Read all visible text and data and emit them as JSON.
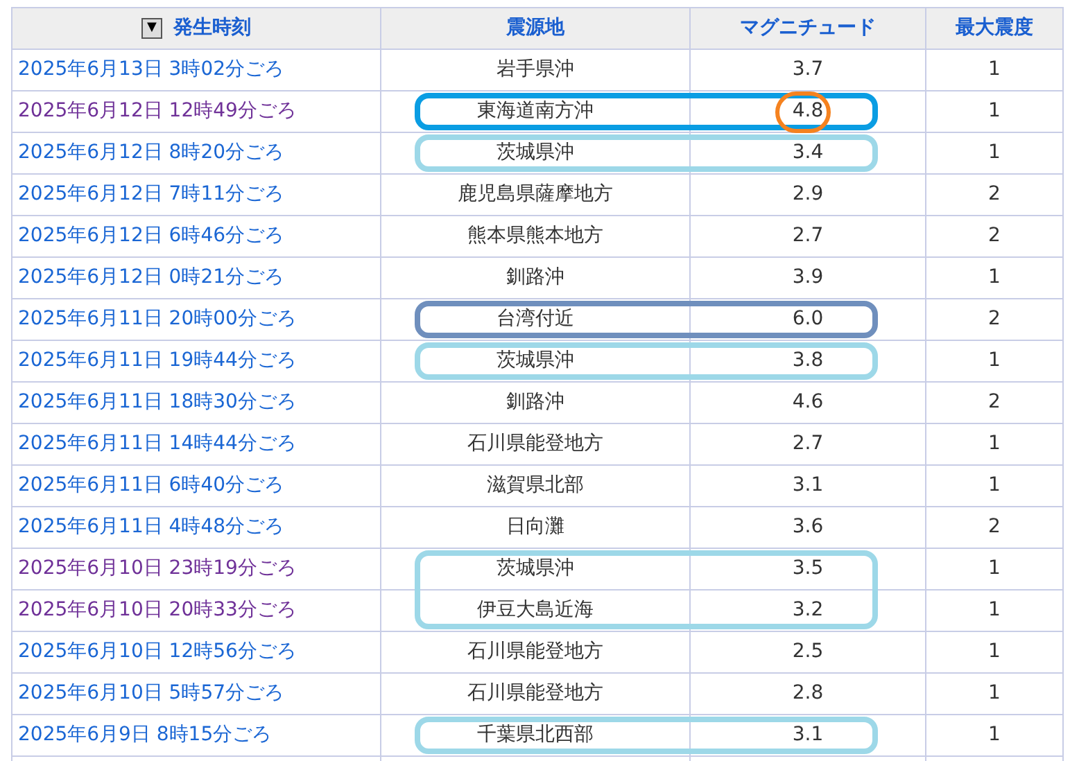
{
  "table": {
    "sort_icon": "▼",
    "columns": [
      "発生時刻",
      "震源地",
      "マグニチュード",
      "最大震度"
    ],
    "rows": [
      {
        "time": "2025年6月13日 3時02分ごろ",
        "visited": false,
        "location": "岩手県沖",
        "magnitude": "3.7",
        "intensity": "1"
      },
      {
        "time": "2025年6月12日 12時49分ごろ",
        "visited": true,
        "location": "東海道南方沖",
        "magnitude": "4.8",
        "intensity": "1",
        "ring": {
          "kind": "single",
          "color": "#0a9de3"
        },
        "magnitude_ring": {
          "color": "#f5821f"
        }
      },
      {
        "time": "2025年6月12日 8時20分ごろ",
        "visited": false,
        "location": "茨城県沖",
        "magnitude": "3.4",
        "intensity": "1",
        "ring": {
          "kind": "single",
          "color": "#9dd8e8"
        }
      },
      {
        "time": "2025年6月12日 7時11分ごろ",
        "visited": false,
        "location": "鹿児島県薩摩地方",
        "magnitude": "2.9",
        "intensity": "2"
      },
      {
        "time": "2025年6月12日 6時46分ごろ",
        "visited": false,
        "location": "熊本県熊本地方",
        "magnitude": "2.7",
        "intensity": "2"
      },
      {
        "time": "2025年6月12日 0時21分ごろ",
        "visited": false,
        "location": "釧路沖",
        "magnitude": "3.9",
        "intensity": "1"
      },
      {
        "time": "2025年6月11日 20時00分ごろ",
        "visited": false,
        "location": "台湾付近",
        "magnitude": "6.0",
        "intensity": "2",
        "ring": {
          "kind": "single",
          "color": "#6f8fbd"
        }
      },
      {
        "time": "2025年6月11日 19時44分ごろ",
        "visited": false,
        "location": "茨城県沖",
        "magnitude": "3.8",
        "intensity": "1",
        "ring": {
          "kind": "single",
          "color": "#9dd8e8"
        }
      },
      {
        "time": "2025年6月11日 18時30分ごろ",
        "visited": false,
        "location": "釧路沖",
        "magnitude": "4.6",
        "intensity": "2"
      },
      {
        "time": "2025年6月11日 14時44分ごろ",
        "visited": false,
        "location": "石川県能登地方",
        "magnitude": "2.7",
        "intensity": "1"
      },
      {
        "time": "2025年6月11日 6時40分ごろ",
        "visited": false,
        "location": "滋賀県北部",
        "magnitude": "3.1",
        "intensity": "1"
      },
      {
        "time": "2025年6月11日 4時48分ごろ",
        "visited": false,
        "location": "日向灘",
        "magnitude": "3.6",
        "intensity": "2"
      },
      {
        "time": "2025年6月10日 23時19分ごろ",
        "visited": true,
        "location": "茨城県沖",
        "magnitude": "3.5",
        "intensity": "1",
        "ring": {
          "kind": "double",
          "color": "#9dd8e8"
        }
      },
      {
        "time": "2025年6月10日 20時33分ごろ",
        "visited": true,
        "location": "伊豆大島近海",
        "magnitude": "3.2",
        "intensity": "1"
      },
      {
        "time": "2025年6月10日 12時56分ごろ",
        "visited": false,
        "location": "石川県能登地方",
        "magnitude": "2.5",
        "intensity": "1"
      },
      {
        "time": "2025年6月10日 5時57分ごろ",
        "visited": false,
        "location": "石川県能登地方",
        "magnitude": "2.8",
        "intensity": "1"
      },
      {
        "time": "2025年6月9日 8時15分ごろ",
        "visited": false,
        "location": "千葉県北西部",
        "magnitude": "3.1",
        "intensity": "1",
        "ring": {
          "kind": "single",
          "color": "#9dd8e8"
        }
      }
    ]
  }
}
